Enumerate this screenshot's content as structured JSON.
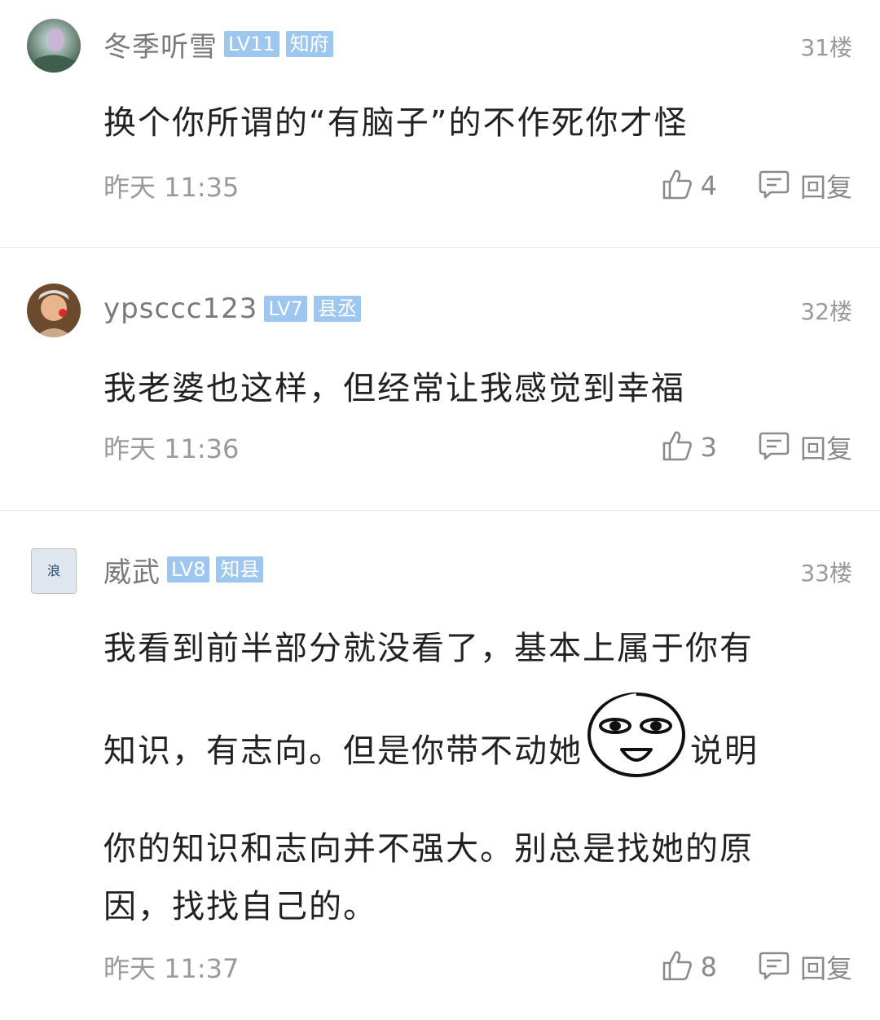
{
  "comments": [
    {
      "username": "冬季听雪",
      "level": "LV11",
      "title": "知府",
      "floor": "31楼",
      "content": "换个你所谓的“有脑子”的不作死你才怪",
      "time": "昨天 11:35",
      "likes": "4",
      "reply_label": "回复"
    },
    {
      "username": "ypsccc123",
      "level": "LV7",
      "title": "县丞",
      "floor": "32楼",
      "content": "我老婆也这样，但经常让我感觉到幸福",
      "time": "昨天 11:36",
      "likes": "3",
      "reply_label": "回复"
    },
    {
      "username": "威武",
      "level": "LV8",
      "title": "知县",
      "floor": "33楼",
      "content_line1": "我看到前半部分就没看了，基本上属于你有",
      "content_line2a": "知识，有志向。但是你带不动她",
      "content_line2b": "说明",
      "content_line3": "你的知识和志向并不强大。别总是找她的原",
      "content_line4": "因，找找自己的。",
      "time": "昨天 11:37",
      "likes": "8",
      "reply_label": "回复",
      "avatar_text": "浪"
    }
  ]
}
